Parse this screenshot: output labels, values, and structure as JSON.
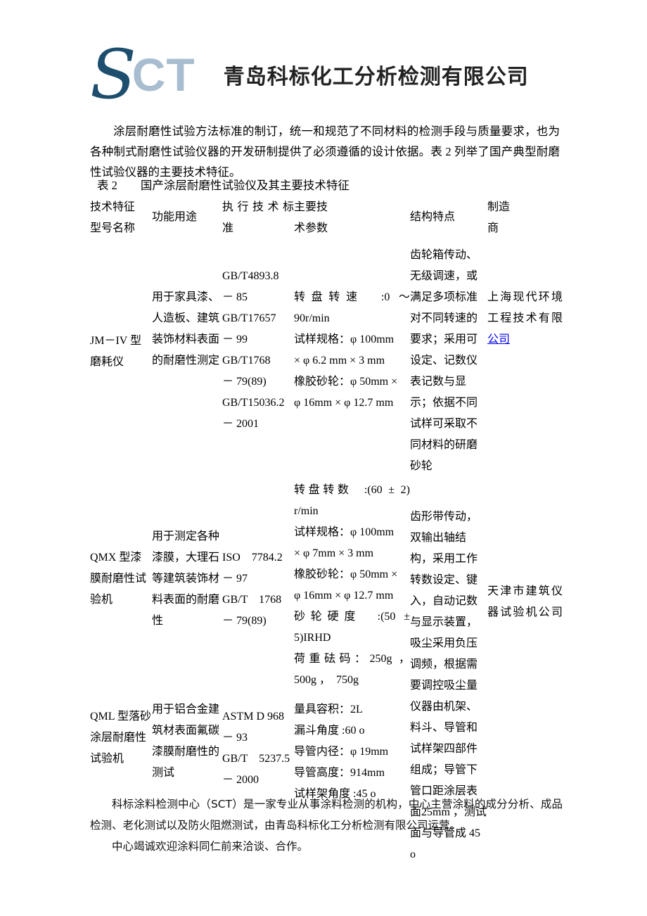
{
  "logo": {
    "mark_s": "S",
    "mark_ct": "CT",
    "company_cn": "青岛科标化工分析检测有限公司",
    "color_s": "#1d4e6e",
    "color_ct": "#a9bdd1"
  },
  "intro": {
    "paragraph": "涂层耐磨性试验方法标准的制订，统一和规范了不同材料的检测手段与质量要求，也为各种制式耐磨性试验仪器的开发研制提供了必须遵循的设计依据。表 2 列举了国产典型耐磨性试验仪器的主要技术特征。",
    "caption": "表 2　　国产涂层耐磨性试验仪及其主要技术特征"
  },
  "table": {
    "headers": {
      "col1_line1": "技术特征",
      "col1_line2": "型号名称",
      "col2": "功能用途",
      "col3_line1": "执行技术标",
      "col3_line2": "准",
      "col4_line1": "主要技",
      "col4_line2": "术参数",
      "col5": "结构特点",
      "col6_line1": "制造",
      "col6_line2": "商"
    },
    "rows": [
      {
        "model": "JM－IV 型磨耗仪",
        "usage": "用于家具漆、人造板、建筑装饰材料表面的耐磨性测定",
        "standards": [
          "GB/T4893.8",
          "－ 85",
          "GB/T17657",
          "－ 99",
          "GB/T1768",
          "－ 79(89)",
          "GB/T15036.2",
          "－ 2001"
        ],
        "params": [
          "转盘转速  :0 ～",
          "90r/min",
          "试样规格：φ 100mm",
          "× φ 6.2 mm × 3 mm",
          "橡胶砂轮：φ 50mm ×",
          "φ 16mm × φ 12.7 mm"
        ],
        "structure": "齿轮箱传动、无级调速，或满足多项标准对不同转速的要求；采用可设定、记数仪表记数与显示；依据不同试样可采取不同材料的研磨砂轮",
        "manufacturer_text": "上海现代环境工程技术有限",
        "manufacturer_link": "公司"
      },
      {
        "model": "QMX 型漆膜耐磨性试验机",
        "usage": "用于测定各种漆膜，大理石等建筑装饰材料表面的耐磨性",
        "standards": [
          "ISO　7784.2",
          "－ 97",
          "GB/T　1768",
          "－ 79(89)"
        ],
        "params": [
          "转盘转数  :(60 ± 2)",
          "r/min",
          "试样规格：φ 100mm",
          "× φ 7mm × 3 mm",
          "橡胶砂轮：φ 50mm ×",
          "φ 16mm × φ 12.7 mm",
          "砂轮硬度  :(50 ±",
          "5)IRHD",
          "荷重砝码：250g ，",
          "500g ，　750g"
        ],
        "structure": "齿形带传动，双输出轴结构，采用工作转数设定、键入，自动记数与显示装置，吸尘采用负压调频，根据需要调控吸尘量",
        "manufacturer_text": "天津市建筑仪器试验机公司",
        "manufacturer_link": ""
      },
      {
        "model": "QML 型落砂涂层耐磨性试验机",
        "usage": "用于铝合金建筑材表面氟碳漆膜耐磨性的测试",
        "standards": [
          "ASTM D 968",
          "－ 93",
          "GB/T　5237.5",
          "－ 2000"
        ],
        "params": [
          "量具容积：2L",
          "漏斗角度 :60 o",
          "导管内径：φ 19mm",
          "导管高度：914mm",
          "试样架角度 :45 o"
        ],
        "structure": "仪器由机架、料斗、导管和试样架四部件组成；导管下管口距涂层表面25mm ，测试面与导管成 45 o",
        "manufacturer_text": "",
        "manufacturer_link": ""
      }
    ]
  },
  "footer": {
    "line1": "科标涂料检测中心（SCT）是一家专业从事涂料检测的机构，中心主营涂料的成分分析、成品检测、老化测试以及防火阻燃测试，由青岛科标化工分析检测有限公司运营。",
    "line2": "中心竭诚欢迎涂料同仁前来洽谈、合作。"
  }
}
